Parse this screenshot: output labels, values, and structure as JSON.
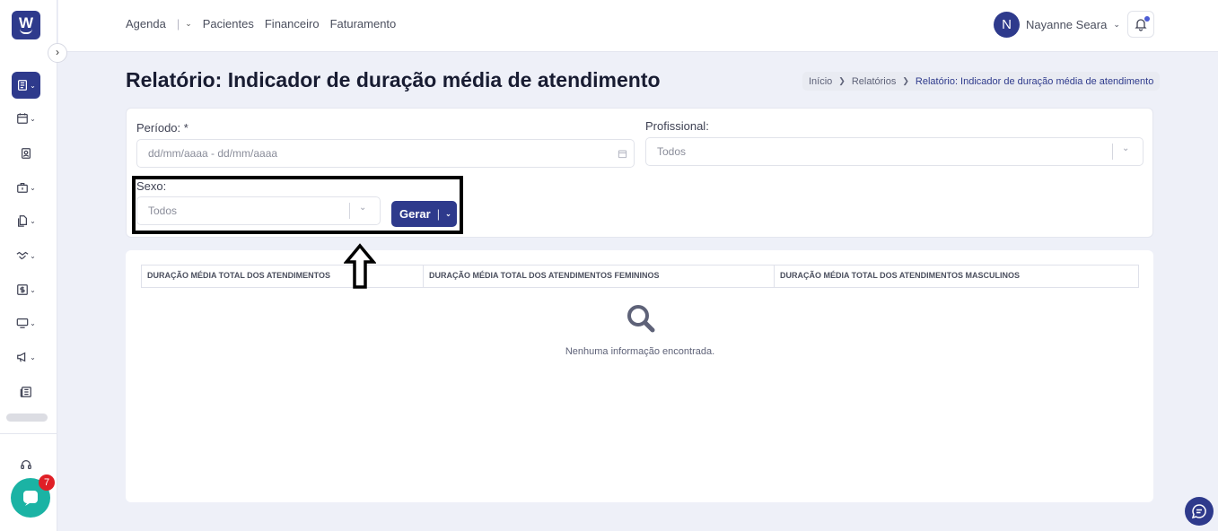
{
  "app": {
    "logo_letter": "W"
  },
  "topnav": {
    "items": [
      "Agenda",
      "Pacientes",
      "Financeiro",
      "Faturamento"
    ],
    "sep": "|"
  },
  "user": {
    "initial": "N",
    "name": "Nayanne Seara"
  },
  "page": {
    "title": "Relatório: Indicador de duração média de atendimento"
  },
  "breadcrumb": {
    "items": [
      "Início",
      "Relatórios",
      "Relatório: Indicador de duração média de atendimento"
    ]
  },
  "filters": {
    "periodo_label": "Período: *",
    "periodo_placeholder": "dd/mm/aaaa - dd/mm/aaaa",
    "profissional_label": "Profissional:",
    "profissional_value": "Todos",
    "sexo_label": "Sexo:",
    "sexo_value": "Todos",
    "gerar_label": "Gerar"
  },
  "table": {
    "columns": [
      "DURAÇÃO MÉDIA TOTAL DOS ATENDIMENTOS",
      "DURAÇÃO MÉDIA TOTAL DOS ATENDIMENTOS FEMININOS",
      "DURAÇÃO MÉDIA TOTAL DOS ATENDIMENTOS MASCULINOS"
    ],
    "empty_message": "Nenhuma informação encontrada."
  },
  "chat": {
    "badge_count": "7"
  },
  "icons": {
    "sidebar": [
      "report-icon",
      "calendar-icon",
      "patient-badge-icon",
      "briefcase-icon",
      "documents-icon",
      "handshake-icon",
      "finance-icon",
      "monitor-icon",
      "megaphone-icon",
      "news-icon",
      "headset-icon"
    ],
    "accent": "#2e3a8c",
    "chat_color": "#1bb3a4",
    "badge_color": "#e01f26"
  }
}
